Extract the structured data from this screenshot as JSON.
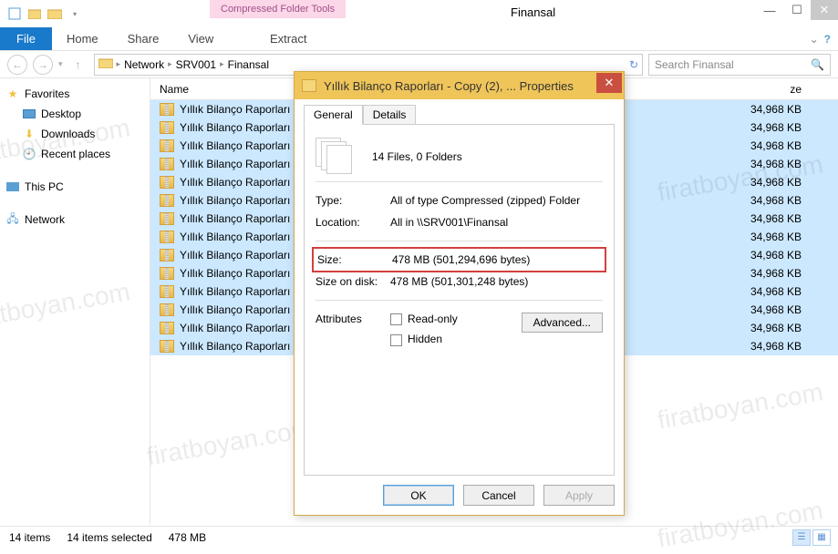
{
  "window": {
    "context_tab": "Compressed Folder Tools",
    "title": "Finansal"
  },
  "ribbon": {
    "file": "File",
    "home": "Home",
    "share": "Share",
    "view": "View",
    "extract": "Extract"
  },
  "breadcrumb": {
    "parts": [
      "Network",
      "SRV001",
      "Finansal"
    ]
  },
  "search": {
    "placeholder": "Search Finansal"
  },
  "tree": {
    "favorites": "Favorites",
    "desktop": "Desktop",
    "downloads": "Downloads",
    "recent": "Recent places",
    "this_pc": "This PC",
    "network": "Network"
  },
  "columns": {
    "name": "Name",
    "size": "ze"
  },
  "files": [
    {
      "name": "Yıllık Bilanço Raporları",
      "size": "34,968 KB"
    },
    {
      "name": "Yıllık Bilanço Raporları",
      "size": "34,968 KB"
    },
    {
      "name": "Yıllık Bilanço Raporları",
      "size": "34,968 KB"
    },
    {
      "name": "Yıllık Bilanço Raporları",
      "size": "34,968 KB"
    },
    {
      "name": "Yıllık Bilanço Raporları",
      "size": "34,968 KB"
    },
    {
      "name": "Yıllık Bilanço Raporları",
      "size": "34,968 KB"
    },
    {
      "name": "Yıllık Bilanço Raporları",
      "size": "34,968 KB"
    },
    {
      "name": "Yıllık Bilanço Raporları",
      "size": "34,968 KB"
    },
    {
      "name": "Yıllık Bilanço Raporları",
      "size": "34,968 KB"
    },
    {
      "name": "Yıllık Bilanço Raporları",
      "size": "34,968 KB"
    },
    {
      "name": "Yıllık Bilanço Raporları",
      "size": "34,968 KB"
    },
    {
      "name": "Yıllık Bilanço Raporları",
      "size": "34,968 KB"
    },
    {
      "name": "Yıllık Bilanço Raporları",
      "size": "34,968 KB"
    },
    {
      "name": "Yıllık Bilanço Raporları",
      "size": "34,968 KB"
    }
  ],
  "status": {
    "items": "14 items",
    "selected": "14 items selected",
    "size": "478 MB"
  },
  "dialog": {
    "title": "Yıllık Bilanço Raporları - Copy (2), ... Properties",
    "tabs": {
      "general": "General",
      "details": "Details"
    },
    "summary": "14 Files, 0 Folders",
    "type_label": "Type:",
    "type_value": "All of type Compressed (zipped) Folder",
    "location_label": "Location:",
    "location_value": "All in \\\\SRV001\\Finansal",
    "size_label": "Size:",
    "size_value": "478 MB (501,294,696 bytes)",
    "disk_label": "Size on disk:",
    "disk_value": "478 MB (501,301,248 bytes)",
    "attr_label": "Attributes",
    "readonly": "Read-only",
    "hidden": "Hidden",
    "advanced": "Advanced...",
    "ok": "OK",
    "cancel": "Cancel",
    "apply": "Apply"
  },
  "watermark": "firatboyan.com"
}
